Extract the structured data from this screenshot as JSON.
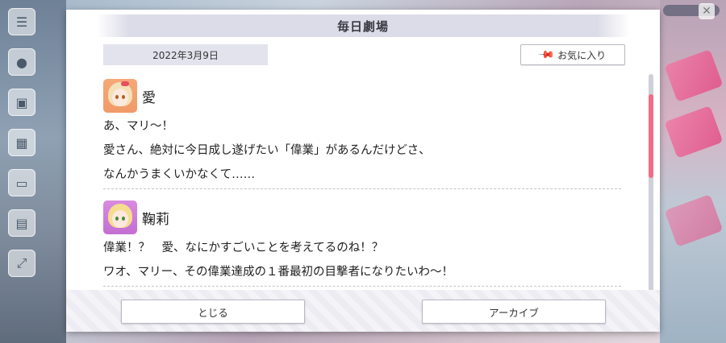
{
  "dialog": {
    "title": "毎日劇場",
    "date": "2022年3月9日",
    "favorite_label": "お気に入り",
    "close_label": "とじる",
    "archive_label": "アーカイブ"
  },
  "entries": [
    {
      "speaker": "愛",
      "lines": [
        "あ、マリ～！",
        "愛さん、絶対に今日成し遂げたい「偉業」があるんだけどさ、",
        "なんかうまくいかなくて……"
      ]
    },
    {
      "speaker": "鞠莉",
      "lines": [
        "偉業！？　愛、なにかすごいことを考えてるのね！？",
        "ワオ、マリー、その偉業達成の１番最初の目撃者になりたいわ～！"
      ]
    }
  ],
  "scroll": {
    "position_fraction": 0.15,
    "visible_fraction": 0.38
  },
  "icons": {
    "favorite": "pin-icon",
    "close_bg": "close-icon"
  },
  "colors": {
    "accent": "#f06d86",
    "title_bar": "#dcdce8"
  }
}
